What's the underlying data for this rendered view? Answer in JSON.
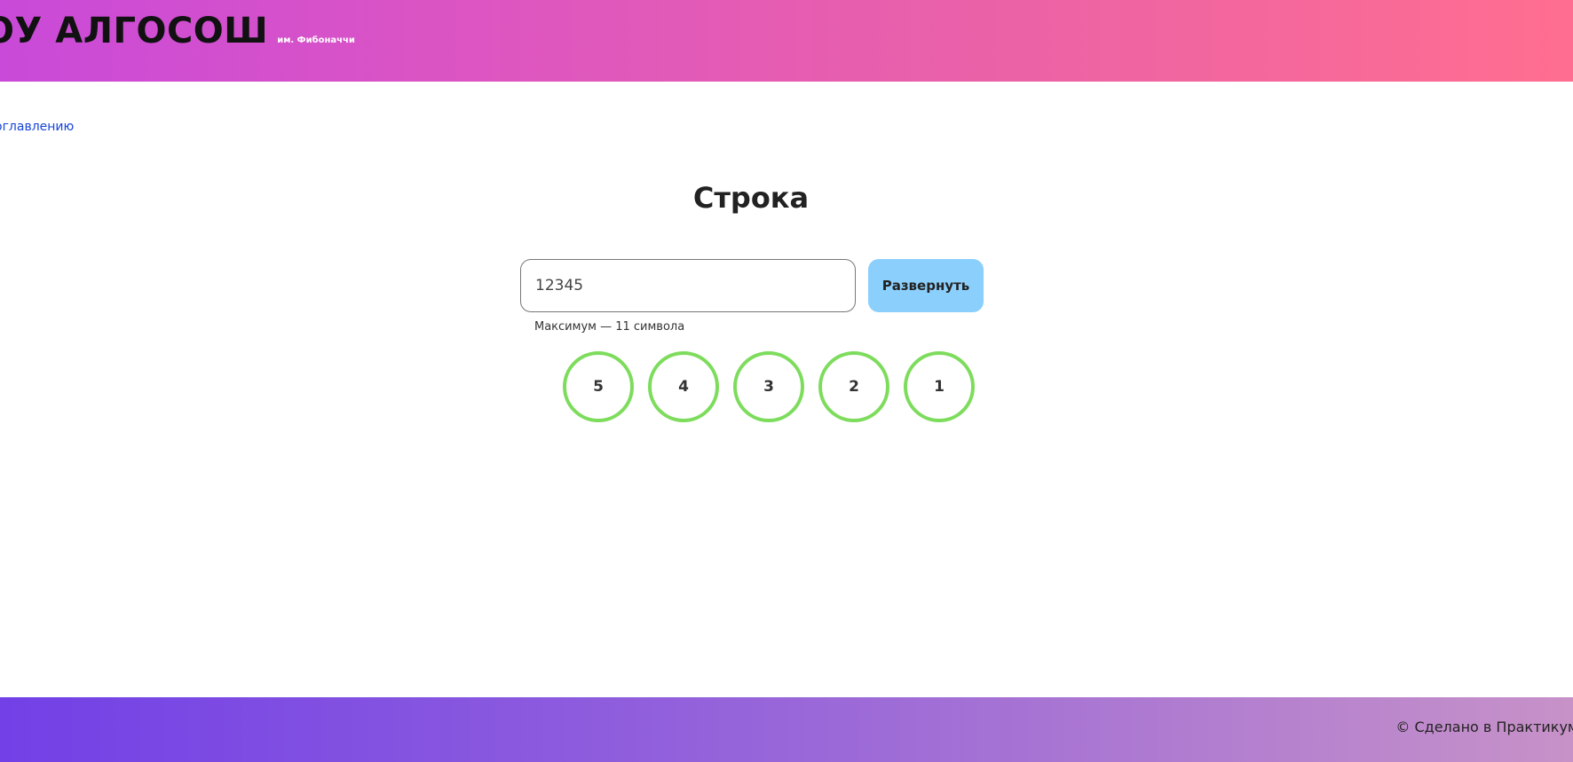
{
  "header": {
    "logo_main": "ОУ АЛГОСОШ",
    "logo_sub": "им. Фибоначчи"
  },
  "nav": {
    "back_link": "оглавлению"
  },
  "main": {
    "title": "Строка",
    "input": {
      "value": "12345",
      "placeholder": ""
    },
    "submit_label": "Развернуть",
    "hint": "Максимум — 11 символа",
    "circles": [
      "5",
      "4",
      "3",
      "2",
      "1"
    ]
  },
  "footer": {
    "text": "© Сделано в Практикум"
  },
  "colors": {
    "circle_border": "#7ddc5c",
    "button_bg": "#8bcffc",
    "link": "#1646d6"
  }
}
